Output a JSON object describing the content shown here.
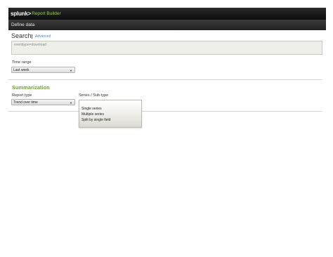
{
  "header": {
    "logo_text": "splunk>",
    "app_title": "Report Builder"
  },
  "subheader": {
    "title": "Define data"
  },
  "search": {
    "label": "Search",
    "advanced_link": "Advanced",
    "value": "eventtype=download"
  },
  "time_range": {
    "label": "Time range",
    "selected": "Last week"
  },
  "summarization": {
    "title": "Summarization",
    "report_type": {
      "label": "Report type",
      "selected": "Trend over time"
    },
    "series": {
      "label": "Series / Sub-type",
      "options": [
        "Single series",
        "Multiple series",
        "Split by single field"
      ]
    }
  },
  "colors": {
    "topbar": "#111111",
    "brand_green": "#9ad04a",
    "section_green": "#6aa33a",
    "link_blue": "#4a86c5"
  },
  "icons": {
    "select_caret": "caret-down-icon"
  }
}
